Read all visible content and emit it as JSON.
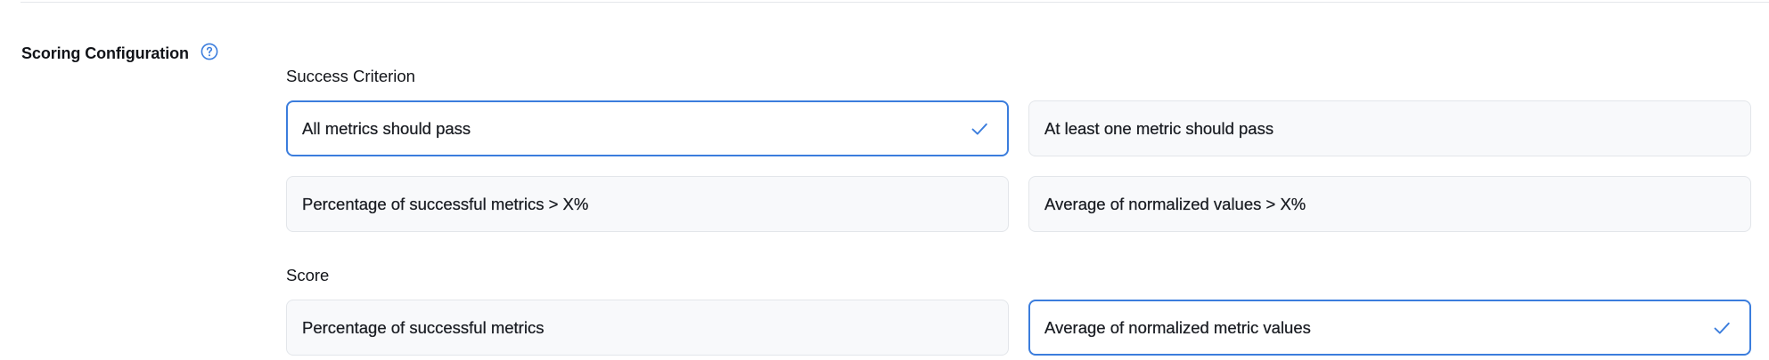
{
  "section": {
    "title": "Scoring Configuration",
    "help_icon": "question-circle-icon"
  },
  "success_criterion": {
    "label": "Success Criterion",
    "options": [
      {
        "label": "All metrics should pass",
        "selected": true
      },
      {
        "label": "At least one metric should pass",
        "selected": false
      },
      {
        "label": "Percentage of successful metrics > X%",
        "selected": false
      },
      {
        "label": "Average of normalized values > X%",
        "selected": false
      }
    ]
  },
  "score": {
    "label": "Score",
    "options": [
      {
        "label": "Percentage of successful metrics",
        "selected": false
      },
      {
        "label": "Average of normalized metric values",
        "selected": true
      }
    ]
  },
  "colors": {
    "accent": "#3b7ddd",
    "option_bg": "#f8f9fb",
    "option_border": "#e3e6ea",
    "text": "#1a1d23"
  }
}
